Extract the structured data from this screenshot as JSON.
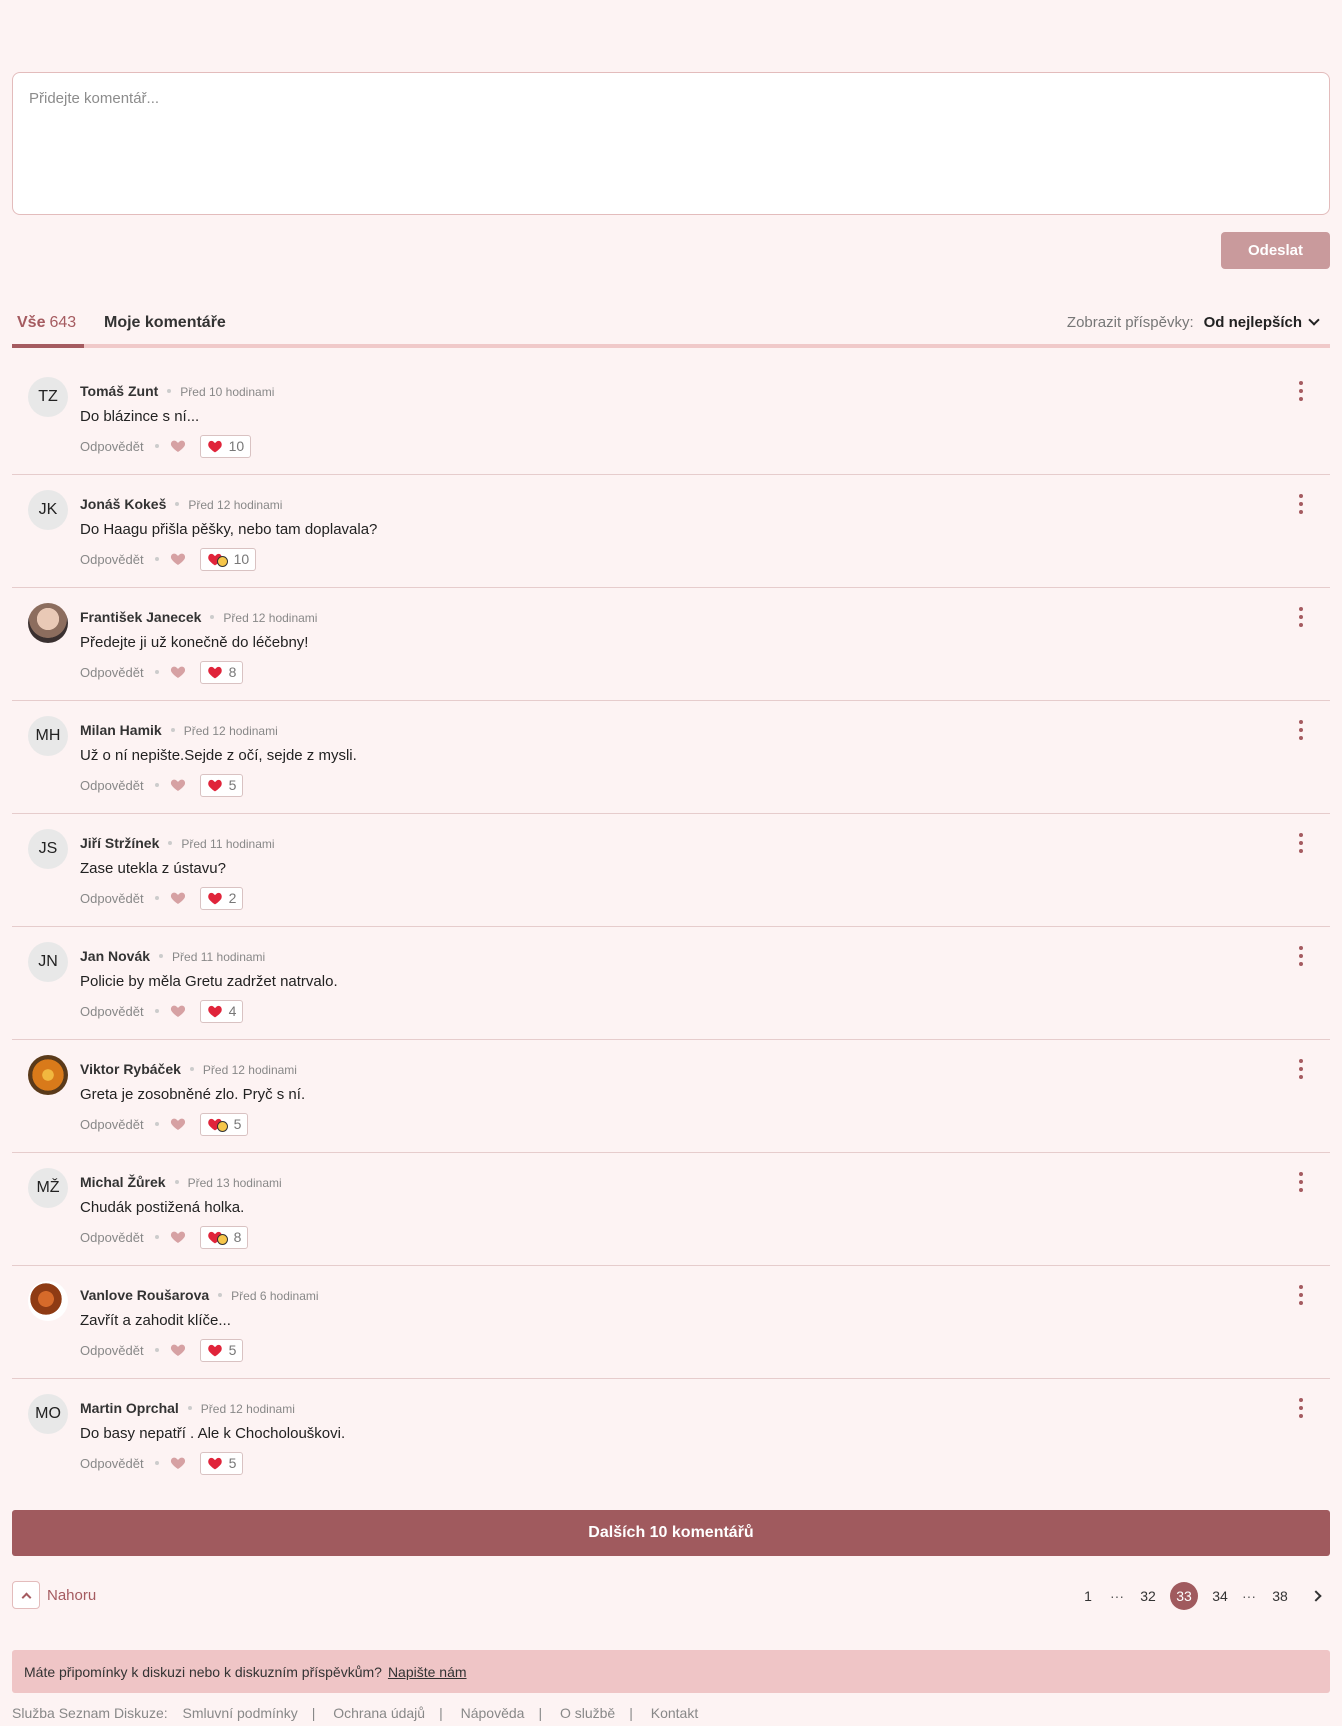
{
  "composer": {
    "placeholder": "Přidejte komentář...",
    "send_label": "Odeslat"
  },
  "tabs": {
    "all_label": "Vše",
    "all_count": "643",
    "mine_label": "Moje komentáře"
  },
  "sort": {
    "label": "Zobrazit příspěvky:",
    "value": "Od nejlepších"
  },
  "colors": {
    "accent": "#a05a5e",
    "background": "#fdf3f3",
    "banner": "#efc5c6"
  },
  "reply_label": "Odpovědět",
  "comments": [
    {
      "initials": "TZ",
      "avatar": "initials",
      "author": "Tomáš Zunt",
      "time": "Před 10 hodinami",
      "text": "Do blázince s ní...",
      "reaction": "heart",
      "count": "10"
    },
    {
      "initials": "JK",
      "avatar": "initials",
      "author": "Jonáš Kokeš",
      "time": "Před 12 hodinami",
      "text": "Do Haagu přišla pěšky, nebo tam doplavala?",
      "reaction": "heart-laugh",
      "count": "10"
    },
    {
      "initials": "",
      "avatar": "photo",
      "author": "František Janecek",
      "time": "Před 12 hodinami",
      "text": "Předejte ji už konečně do léčebny!",
      "reaction": "heart",
      "count": "8"
    },
    {
      "initials": "MH",
      "avatar": "initials",
      "author": "Milan Hamik",
      "time": "Před 12 hodinami",
      "text": "Už o ní nepište.Sejde z očí, sejde z mysli.",
      "reaction": "heart",
      "count": "5"
    },
    {
      "initials": "JS",
      "avatar": "initials",
      "author": "Jiří Stržínek",
      "time": "Před 11 hodinami",
      "text": "Zase utekla z ústavu?",
      "reaction": "heart",
      "count": "2"
    },
    {
      "initials": "JN",
      "avatar": "initials",
      "author": "Jan Novák",
      "time": "Před 11 hodinami",
      "text": "Policie by měla Gretu zadržet natrvalo.",
      "reaction": "heart",
      "count": "4"
    },
    {
      "initials": "",
      "avatar": "photo",
      "author": "Viktor Rybáček",
      "time": "Před 12 hodinami",
      "text": "Greta je zosobněné zlo. Pryč s ní.",
      "reaction": "heart-laugh",
      "count": "5"
    },
    {
      "initials": "MŽ",
      "avatar": "initials",
      "author": "Michal Žůrek",
      "time": "Před 13 hodinami",
      "text": "Chudák postižená holka.",
      "reaction": "heart-laugh",
      "count": "8"
    },
    {
      "initials": "",
      "avatar": "photo",
      "author": "Vanlove Roušarova",
      "time": "Před 6 hodinami",
      "text": "Zavřít a zahodit klíče...",
      "reaction": "heart",
      "count": "5"
    },
    {
      "initials": "MO",
      "avatar": "initials",
      "author": "Martin Oprchal",
      "time": "Před 12 hodinami",
      "text": "Do basy nepatří . Ale k Chocholouškovi.",
      "reaction": "heart",
      "count": "5"
    }
  ],
  "more_button": "Dalších 10 komentářů",
  "top_link": "Nahoru",
  "pagination": {
    "first": "1",
    "ellipsis": "···",
    "prev": "32",
    "current": "33",
    "next": "34",
    "last": "38"
  },
  "feedback": {
    "text": "Máte připomínky k diskuzi nebo k diskuzním příspěvkům?",
    "link": "Napište nám"
  },
  "footer": {
    "service": "Služba Seznam Diskuze:",
    "links": [
      "Smluvní podmínky",
      "Ochrana údajů",
      "Nápověda",
      "O službě",
      "Kontakt"
    ]
  }
}
